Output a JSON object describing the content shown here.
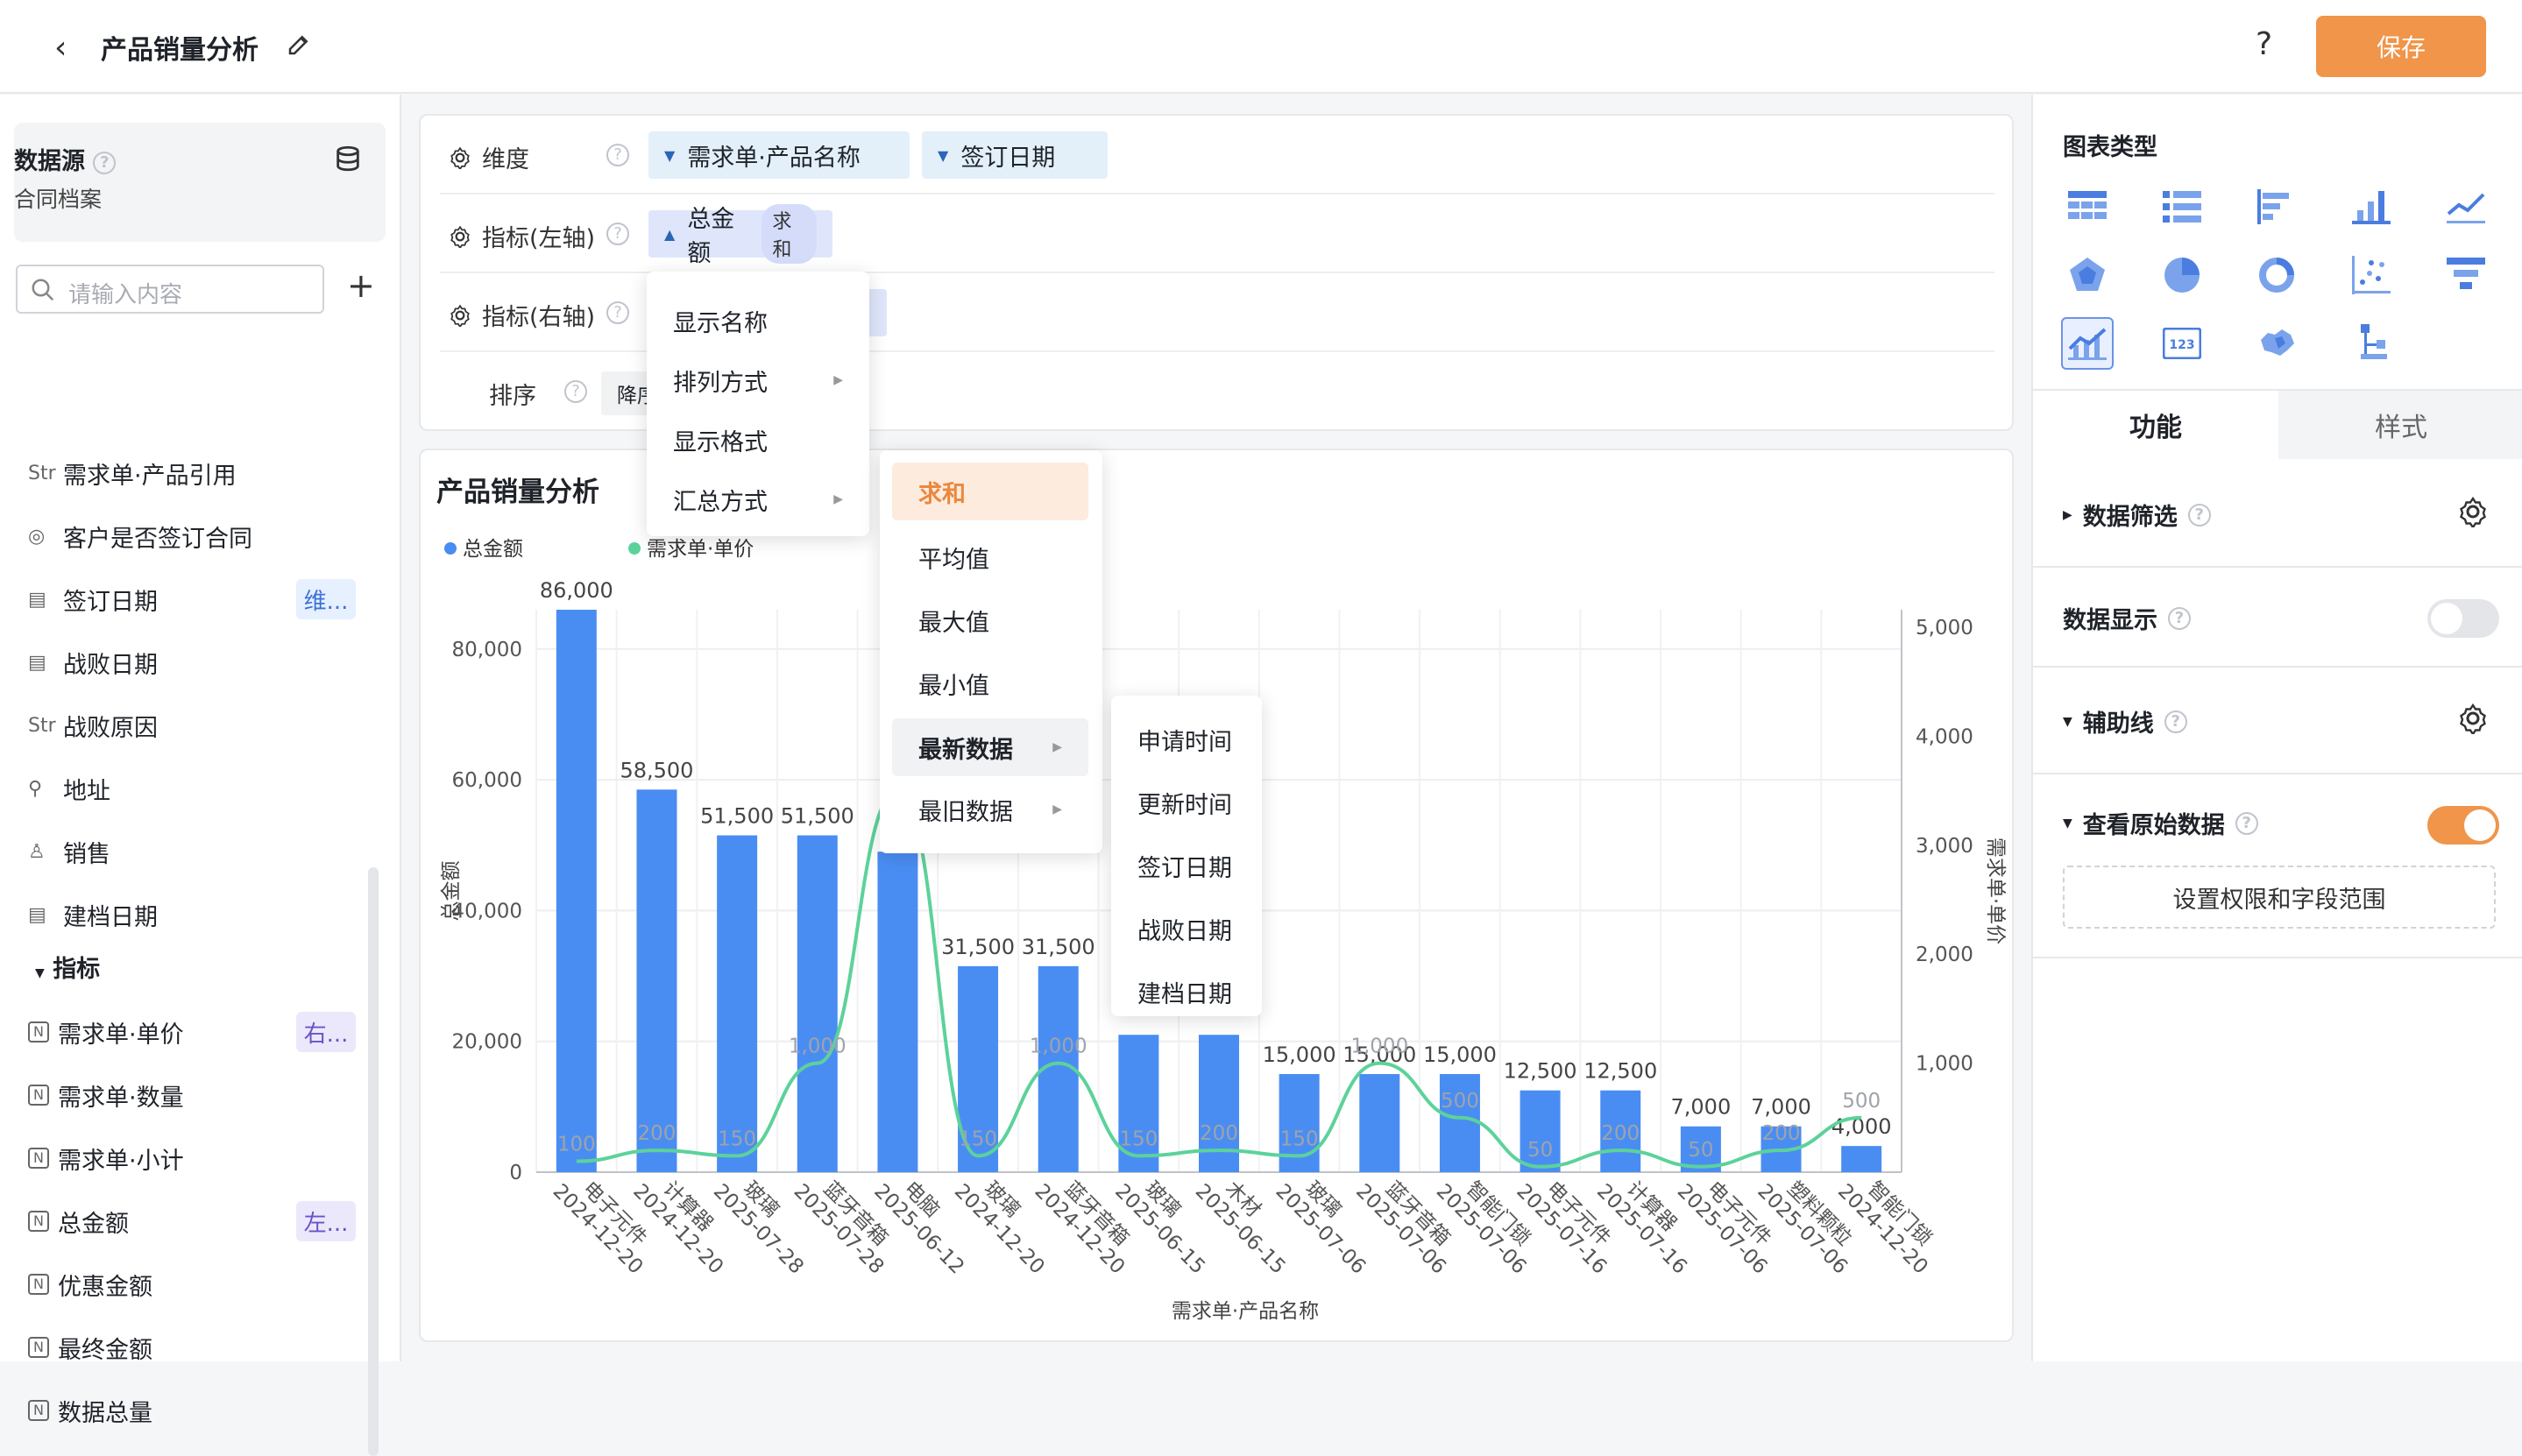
{
  "header": {
    "title": "产品销量分析",
    "save_label": "保存",
    "help_label": "?"
  },
  "left": {
    "datasource_title": "数据源",
    "datasource_name": "合同档案",
    "search_placeholder": "请输入内容",
    "fields": [
      {
        "icon": "Str",
        "label": "需求单·产品引用"
      },
      {
        "icon": "◎",
        "label": "客户是否签订合同"
      },
      {
        "icon": "▤",
        "label": "签订日期",
        "tag": "维..."
      },
      {
        "icon": "▤",
        "label": "战败日期"
      },
      {
        "icon": "Str",
        "label": "战败原因"
      },
      {
        "icon": "⚲",
        "label": "地址"
      },
      {
        "icon": "♙",
        "label": "销售"
      },
      {
        "icon": "▤",
        "label": "建档日期"
      }
    ],
    "metrics_group": "指标",
    "metrics": [
      {
        "icon": "N",
        "label": "需求单·单价",
        "tag": "右..."
      },
      {
        "icon": "N",
        "label": "需求单·数量"
      },
      {
        "icon": "N",
        "label": "需求单·小计"
      },
      {
        "icon": "N",
        "label": "总金额",
        "tag": "左..."
      },
      {
        "icon": "N",
        "label": "优惠金额"
      },
      {
        "icon": "N",
        "label": "最终金额"
      },
      {
        "icon": "N",
        "label": "数据总量"
      }
    ]
  },
  "config": {
    "dimension_label": "维度",
    "dimension_pills": [
      "需求单·产品名称",
      "签订日期"
    ],
    "left_metric_label": "指标(左轴)",
    "left_metric_pill": "总金额",
    "left_metric_agg": "求和",
    "right_metric_label": "指标(右轴)",
    "sort_label": "排序",
    "sort_value": "降序"
  },
  "menus": {
    "main": [
      "显示名称",
      "排列方式",
      "显示格式",
      "汇总方式"
    ],
    "aggregate": [
      "求和",
      "平均值",
      "最大值",
      "最小值",
      "最新数据",
      "最旧数据"
    ],
    "latest": [
      "申请时间",
      "更新时间",
      "签订日期",
      "战败日期",
      "建档日期"
    ]
  },
  "right": {
    "chart_type_title": "图表类型",
    "tab_function": "功能",
    "tab_style": "样式",
    "filter_label": "数据筛选",
    "display_label": "数据显示",
    "auxline_label": "辅助线",
    "raw_label": "查看原始数据",
    "perm_button": "设置权限和字段范围"
  },
  "chart_data": {
    "type": "bar",
    "title": "产品销量分析",
    "xlabel": "需求单·产品名称",
    "ylabel": "总金额",
    "y2label": "需求单·单价",
    "ylim": [
      0,
      86000
    ],
    "y2lim": [
      0,
      5000
    ],
    "yticks": [
      0,
      20000,
      40000,
      60000,
      80000
    ],
    "y2ticks": [
      1000,
      2000,
      3000,
      4000,
      5000
    ],
    "legend_position": "top-left",
    "categories": [
      [
        "电子元件",
        "2024-12-20"
      ],
      [
        "计算器",
        "2024-12-20"
      ],
      [
        "玻璃",
        "2025-07-28"
      ],
      [
        "蓝牙音箱",
        "2025-07-28"
      ],
      [
        "电脑",
        "2025-06-12"
      ],
      [
        "玻璃",
        "2024-12-20"
      ],
      [
        "蓝牙音箱",
        "2024-12-20"
      ],
      [
        "玻璃",
        "2025-06-15"
      ],
      [
        "木材",
        "2025-06-15"
      ],
      [
        "玻璃",
        "2025-07-06"
      ],
      [
        "蓝牙音箱",
        "2025-07-06"
      ],
      [
        "智能门锁",
        "2025-07-06"
      ],
      [
        "电子元件",
        "2025-07-16"
      ],
      [
        "计算器",
        "2025-07-16"
      ],
      [
        "电子元件",
        "2025-07-06"
      ],
      [
        "塑料颗粒",
        "2025-07-06"
      ],
      [
        "智能门锁",
        "2024-12-20"
      ]
    ],
    "series": [
      {
        "name": "总金额",
        "type": "bar",
        "color": "#4a8df2",
        "values": [
          86000,
          58500,
          51500,
          51500,
          49000,
          31500,
          31500,
          21000,
          21000,
          15000,
          15000,
          15000,
          12500,
          12500,
          7000,
          7000,
          4000
        ],
        "labels": [
          "86,000",
          "58,500",
          "51,500",
          "51,500",
          "",
          "31,500",
          "31,500",
          "",
          "",
          "15,000",
          "15,000",
          "15,000",
          "12,500",
          "12,500",
          "7,000",
          "7,000",
          "4,000"
        ]
      },
      {
        "name": "需求单·单价",
        "type": "line",
        "color": "#5cd29a",
        "axis": "right",
        "values": [
          100,
          200,
          150,
          1000,
          3500,
          150,
          1000,
          150,
          200,
          150,
          1000,
          500,
          50,
          200,
          50,
          200,
          500
        ],
        "labels": [
          "100",
          "200",
          "150",
          "1,000",
          "",
          "150",
          "1,000",
          "150",
          "200",
          "150",
          "1,000",
          "500",
          "50",
          "200",
          "50",
          "200",
          "500"
        ]
      }
    ]
  }
}
